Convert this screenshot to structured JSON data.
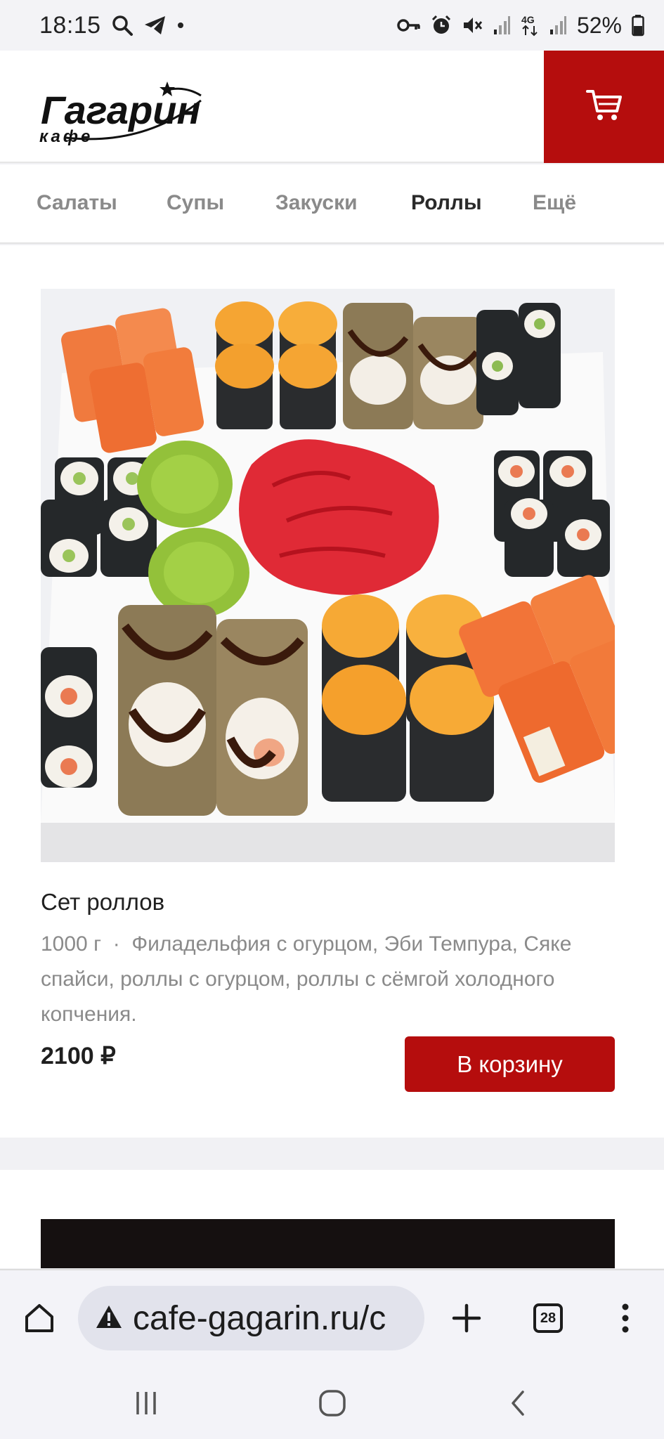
{
  "status_bar": {
    "time": "18:15",
    "battery": "52%",
    "icons": [
      "search-icon",
      "telegram-icon",
      "dot-icon",
      "key-icon",
      "alarm-icon",
      "mute-icon",
      "signal-icon",
      "4g-icon",
      "signal-icon",
      "battery-icon"
    ]
  },
  "header": {
    "logo_name": "Гагарин",
    "logo_sub": "кафе",
    "cart_icon": "cart-icon",
    "accent_color": "#b50d0d"
  },
  "categories": [
    {
      "label": "Салаты",
      "active": false
    },
    {
      "label": "Супы",
      "active": false
    },
    {
      "label": "Закуски",
      "active": false
    },
    {
      "label": "Роллы",
      "active": true
    },
    {
      "label": "Ещё",
      "active": false
    }
  ],
  "product": {
    "title": "Сет роллов",
    "weight": "1000 г",
    "separator": "·",
    "description": "Филадельфия с огурцом, Эби Темпура, Сяке спайси, роллы с огурцом, роллы с сёмгой холодного копчения.",
    "price": "2100 ₽",
    "add_button": "В корзину"
  },
  "browser": {
    "url": "cafe-gagarin.ru/c",
    "tabs_count": "28",
    "icons": [
      "home-icon",
      "warning-icon",
      "plus-icon",
      "tabs-icon",
      "more-icon"
    ]
  },
  "system_nav": {
    "icons": [
      "recents-icon",
      "home-circle-icon",
      "back-icon"
    ]
  }
}
